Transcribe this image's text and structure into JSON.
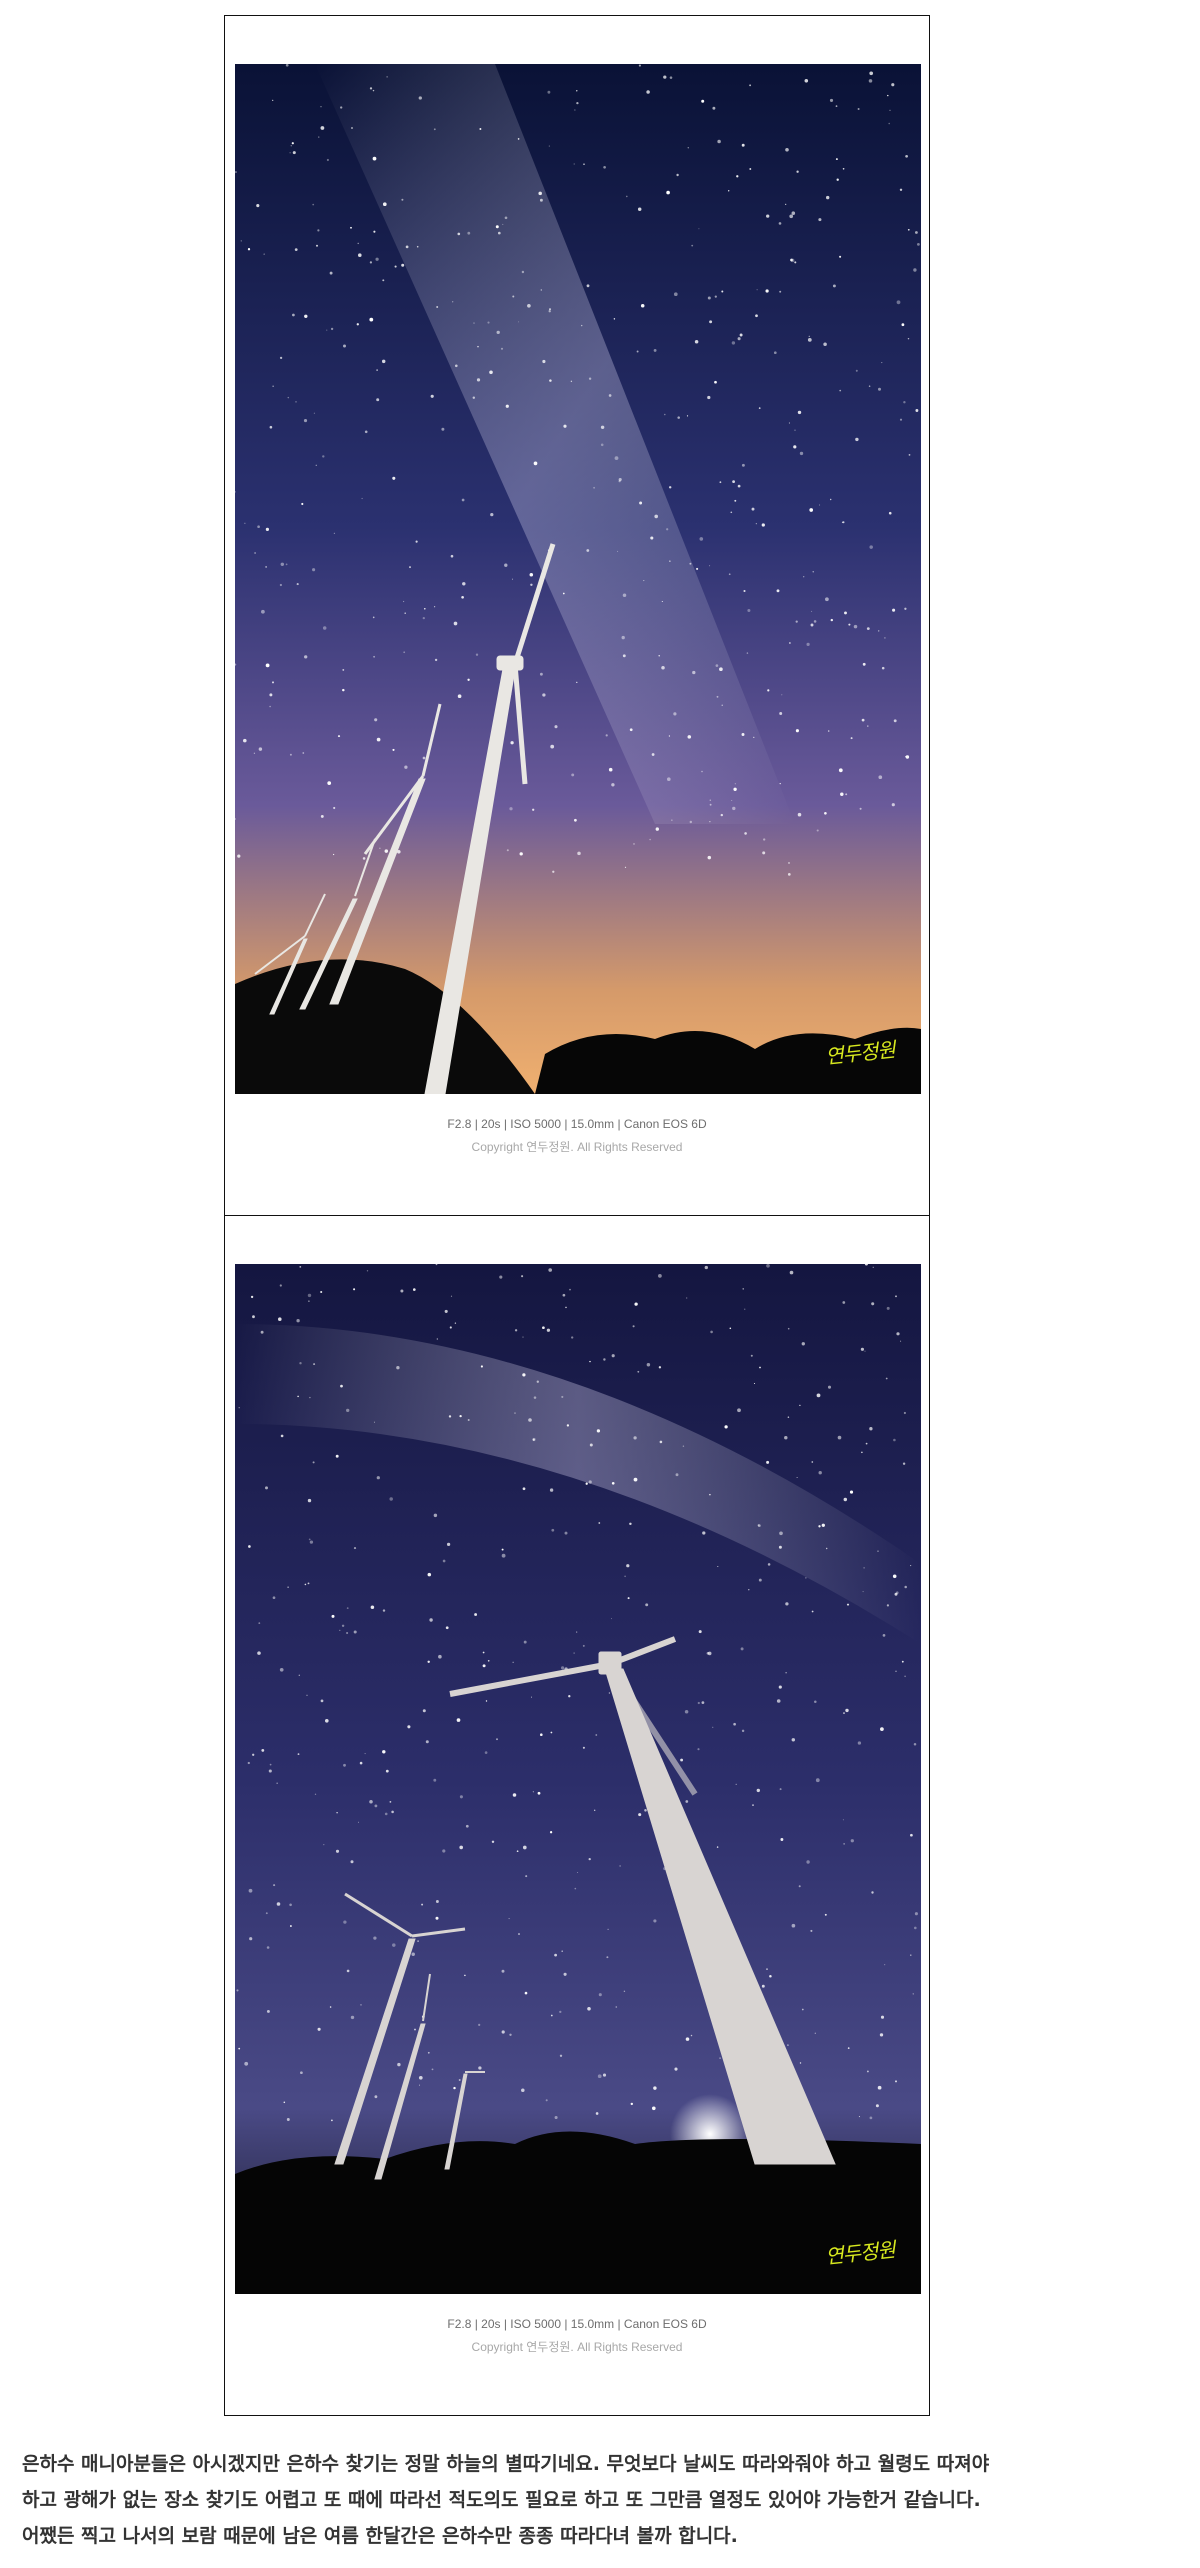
{
  "photos": [
    {
      "name": "milky-way-turbines-1",
      "exif": "F2.8 | 20s | ISO 5000 | 15.0mm | Canon EOS 6D",
      "copyright": "Copyright 연두정원. All Rights Reserved",
      "signature": "연두정원"
    },
    {
      "name": "milky-way-turbines-2",
      "exif": "F2.8 | 20s | ISO 5000 | 15.0mm | Canon EOS 6D",
      "copyright": "Copyright 연두정원. All Rights Reserved",
      "signature": "연두정원"
    }
  ],
  "caption": {
    "line1": "은하수 매니아분들은 아시겠지만 은하수 찾기는 정말 하늘의 별따기네요. 무엇보다 날씨도 따라와줘야 하고 월령도 따져야",
    "line2": "하고 광해가 없는 장소 찾기도 어렵고 또 때에 따라선 적도의도 필요로 하고 또 그만큼 열정도 있어야 가능한거 같습니다.",
    "line3": "어쨌든 찍고 나서의 보람 때문에 남은 여름 한달간은 은하수만 종종 따라다녀 볼까 합니다."
  },
  "colors": {
    "sky_top": "#0b1030",
    "sky_mid": "#3a3a7a",
    "horizon_glow": "#e0a866",
    "ground": "#050505",
    "signature": "#d8e91f"
  }
}
